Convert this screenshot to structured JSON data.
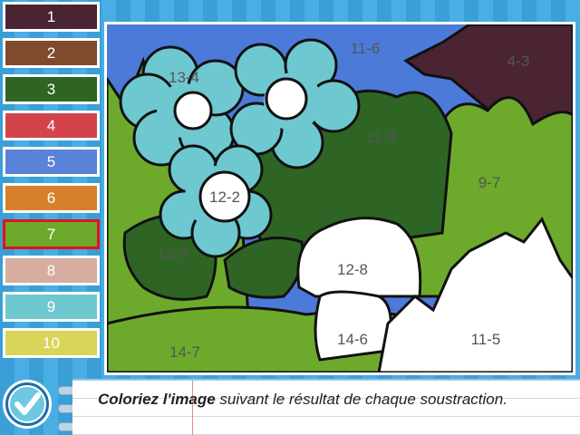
{
  "palette": [
    {
      "label": "1",
      "color": "#4a2433"
    },
    {
      "label": "2",
      "color": "#7f4a2d"
    },
    {
      "label": "3",
      "color": "#2f6524"
    },
    {
      "label": "4",
      "color": "#d2444a"
    },
    {
      "label": "5",
      "color": "#5a82d8"
    },
    {
      "label": "6",
      "color": "#d6802c"
    },
    {
      "label": "7",
      "color": "#6daa2c",
      "selected": true
    },
    {
      "label": "8",
      "color": "#d6ada0"
    },
    {
      "label": "9",
      "color": "#6ec8cf"
    },
    {
      "label": "10",
      "color": "#d9d45a"
    }
  ],
  "picture": {
    "regions": {
      "sky": "11-6",
      "hill": "4-3",
      "flower_top_left": "13-4",
      "flower_center": "12-2",
      "bush_dark": "11-8",
      "bush_right": "9-7",
      "leaf": "12-9",
      "cloud_white": "12-8",
      "ground_left": "14-7",
      "ground_white": "14-6",
      "burst_white": "11-5"
    }
  },
  "instruction": {
    "bold": "Coloriez l'image",
    "rest": " suivant le résultat de chaque soustraction."
  },
  "check_button": "checkmark-icon"
}
